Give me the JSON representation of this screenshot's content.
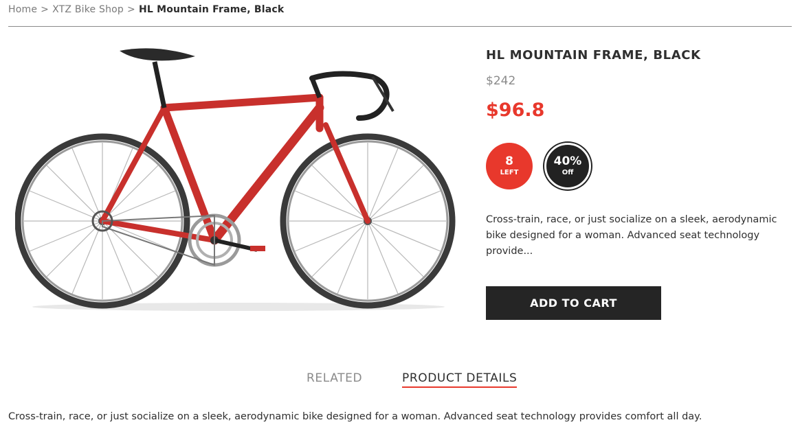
{
  "breadcrumb": {
    "home": "Home",
    "separator": ">",
    "shop": "XTZ Bike Shop",
    "current": "HL Mountain Frame, Black"
  },
  "product": {
    "title": "HL MOUNTAIN FRAME, BLACK",
    "old_price": "$242",
    "price": "$96.8",
    "stock_badge": {
      "count": "8",
      "label": "LEFT"
    },
    "discount_badge": {
      "percent": "40%",
      "label": "Off"
    },
    "short_description": "Cross-train, race, or just socialize on a sleek, aerodynamic bike designed for a woman. Advanced seat technology provide...",
    "add_to_cart_label": "ADD TO CART",
    "image_icon": "bicycle-image"
  },
  "tabs": [
    {
      "label": "RELATED",
      "active": false
    },
    {
      "label": "PRODUCT DETAILS",
      "active": true
    }
  ],
  "details": {
    "text": "Cross-train, race, or just socialize on a sleek, aerodynamic bike designed for a woman. Advanced seat technology provides comfort all day."
  },
  "colors": {
    "accent": "#e8382c",
    "dark": "#252525",
    "frame_red": "#c8302c"
  }
}
